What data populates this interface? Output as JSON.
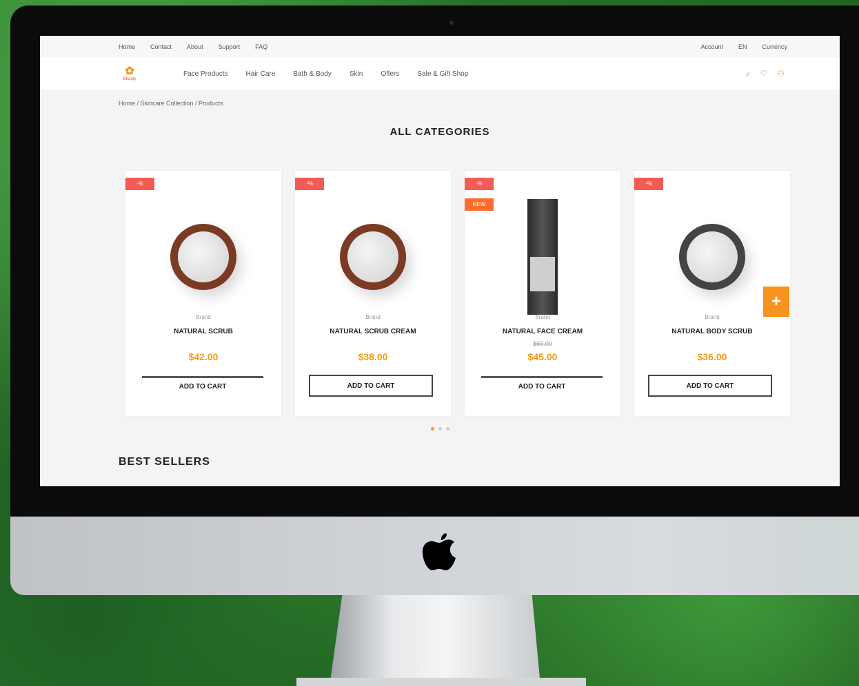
{
  "topbar": {
    "left_links": [
      "Home",
      "Contact",
      "About",
      "Support",
      "FAQ"
    ],
    "right_links": [
      "Account",
      "EN",
      "Currency"
    ]
  },
  "nav": {
    "logo_text": "Beauty",
    "menu": [
      "Face Products",
      "Hair Care",
      "Bath & Body",
      "Skin",
      "Offers",
      "Sale & Gift Shop"
    ]
  },
  "breadcrumb": "Home / Skincare Collection / Products",
  "section_title": "ALL CATEGORIES",
  "products": [
    {
      "badge": "-%",
      "brand": "Brand",
      "name": "NATURAL SCRUB",
      "price": "$42.00",
      "button": "ADD TO CART"
    },
    {
      "badge": "-%",
      "brand": "Brand",
      "name": "NATURAL SCRUB CREAM",
      "price": "$38.00",
      "button": "ADD TO CART"
    },
    {
      "badge": "-%",
      "badge2": "NEW",
      "brand": "Brand",
      "name": "NATURAL FACE CREAM",
      "old_price": "$60.00",
      "price": "$45.00",
      "button": "ADD TO CART"
    },
    {
      "badge": "-%",
      "brand": "Brand",
      "name": "NATURAL BODY SCRUB",
      "price": "$36.00",
      "button": "ADD TO CART"
    }
  ],
  "next_label": "+",
  "section2_title": "BEST SELLERS",
  "colors": {
    "accent": "#f29a1a",
    "badge": "#f25c54"
  }
}
